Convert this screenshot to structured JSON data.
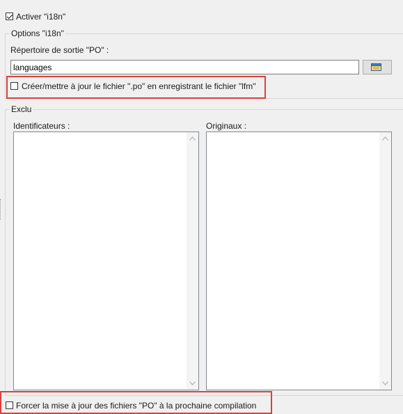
{
  "activate": {
    "label": "Activer \"i18n\"",
    "checked": true
  },
  "options_group": {
    "title": "Options \"i18n\"",
    "output_dir_label": "Répertoire de sortie \"PO\" :",
    "output_dir_value": "languages",
    "browse_icon": "folder-icon",
    "update_po": {
      "label": "Créer/mettre à jour le fichier \".po\" en enregistrant le fichier \"lfm\"",
      "checked": false
    }
  },
  "excluded_group": {
    "title": "Exclu",
    "identifiers_label": "Identificateurs :",
    "originals_label": "Originaux :"
  },
  "force_update": {
    "label": "Forcer la mise à jour des fichiers \"PO\" à la prochaine compilation",
    "checked": false
  },
  "colors": {
    "highlight": "#d9403c",
    "panel_bg": "#f0f0f0"
  }
}
